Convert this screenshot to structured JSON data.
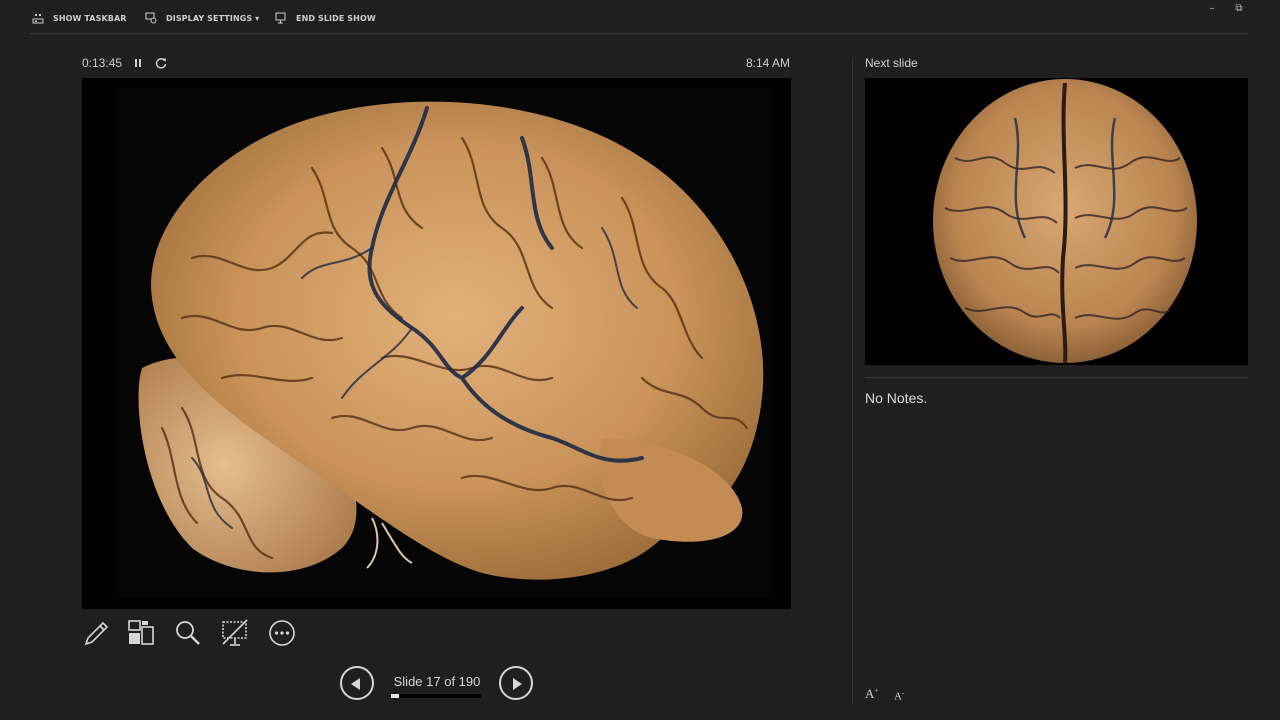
{
  "toolbar": {
    "show_taskbar": "SHOW TASKBAR",
    "display_settings": "DISPLAY SETTINGS ▾",
    "end_slide_show": "END SLIDE SHOW"
  },
  "window_controls": {
    "minimize": "–",
    "restore": "⧉"
  },
  "presenter": {
    "elapsed_time": "0:13:45",
    "clock": "8:14 AM"
  },
  "navigation": {
    "slide_counter": "Slide 17 of 190",
    "current_slide": 17,
    "total_slides": 190,
    "progress_fraction": 0.089
  },
  "next_slide": {
    "label": "Next slide"
  },
  "notes": {
    "text": "No Notes.",
    "increase_font": "A",
    "decrease_font": "A"
  },
  "tools": [
    "pen-tool",
    "see-all-slides",
    "zoom",
    "black-screen",
    "more-options"
  ],
  "colors": {
    "background": "#1f1f1f",
    "slide_background": "#000000",
    "brain_tone": "#c9935a",
    "vessel_tone": "#1d2a45"
  }
}
